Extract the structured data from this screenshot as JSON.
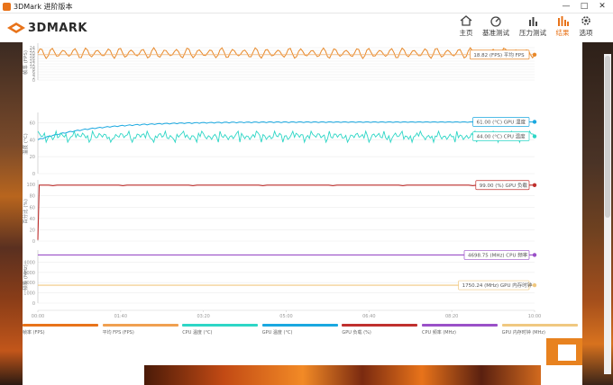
{
  "window": {
    "title": "3DMark 进阶版本",
    "minimize": "—",
    "maximize": "□",
    "close": "✕"
  },
  "header": {
    "logo": "3DMARK",
    "nav": [
      {
        "label": "主页",
        "icon": "home-icon"
      },
      {
        "label": "基准测试",
        "icon": "gauge-icon"
      },
      {
        "label": "压力测试",
        "icon": "stress-bars-icon"
      },
      {
        "label": "结果",
        "icon": "results-bars-icon",
        "active": true
      },
      {
        "label": "选项",
        "icon": "gear-icon"
      }
    ]
  },
  "colors": {
    "accent": "#e8731a",
    "fps": "#e8892a",
    "fps_avg": "#f0b070",
    "cpu_temp": "#2ed6c6",
    "gpu_temp": "#1aa8e0",
    "gpu_load": "#c0302e",
    "cpu_clock": "#9a50c8",
    "gpu_mem_clock": "#f0c880"
  },
  "chart_data": [
    {
      "type": "line",
      "ylabel": "帧率 (FPS)",
      "ylim": [
        0,
        26
      ],
      "yticks": [
        0,
        2,
        4,
        6,
        8,
        10,
        12,
        14,
        16,
        18,
        20,
        22,
        24
      ],
      "series": [
        {
          "name": "帧率 (FPS)",
          "pattern": "oscillating",
          "min": 16,
          "max": 24
        },
        {
          "name": "平均 FPS",
          "value": 18.82
        }
      ],
      "callout": "18.82 (FPS) 平均 FPS"
    },
    {
      "type": "line",
      "ylabel": "温度 (°C)",
      "ylim": [
        0,
        70
      ],
      "yticks": [
        0,
        20,
        40,
        60
      ],
      "series": [
        {
          "name": "GPU 温度 (°C)",
          "start": 40,
          "end": 61
        },
        {
          "name": "CPU 温度 (°C)",
          "mean": 44,
          "min": 37,
          "max": 50
        }
      ],
      "callouts": [
        "61.00 (°C) GPU 温度",
        "44.00 (°C) CPU 温度"
      ]
    },
    {
      "type": "line",
      "ylabel": "百分比 (%)",
      "ylim": [
        0,
        105
      ],
      "yticks": [
        0,
        20,
        40,
        60,
        80,
        100
      ],
      "series": [
        {
          "name": "GPU 负载 (%)",
          "start": 2,
          "end": 99
        }
      ],
      "callout": "99.00 (%) GPU 负载"
    },
    {
      "type": "line",
      "ylabel": "频率 (MHz)",
      "ylim": [
        0,
        5000
      ],
      "yticks": [
        0,
        1000,
        2000,
        3000,
        4000
      ],
      "series": [
        {
          "name": "CPU 频率 (MHz)",
          "value": 4698.75
        },
        {
          "name": "GPU 内存时钟 (MHz)",
          "value": 1750.24
        }
      ],
      "callouts": [
        "4698.75 (MHz) CPU 频率",
        "1750.24 (MHz) GPU 内存时钟"
      ]
    }
  ],
  "xaxis": {
    "ticks": [
      "00:00",
      "01:40",
      "03:20",
      "05:00",
      "06:40",
      "08:20",
      "10:00"
    ]
  },
  "legend": [
    {
      "label": "帧率 (FPS)",
      "color": "#e8731a"
    },
    {
      "label": "平均 FPS (FPS)",
      "color": "#f0a050"
    },
    {
      "label": "CPU 温度 (°C)",
      "color": "#2ed6c6"
    },
    {
      "label": "GPU 温度 (°C)",
      "color": "#1aa8e0"
    },
    {
      "label": "GPU 负载 (%)",
      "color": "#c0302e"
    },
    {
      "label": "CPU 频率 (MHz)",
      "color": "#9a50c8"
    },
    {
      "label": "GPU 内存时钟 (MHz)",
      "color": "#f0c880"
    }
  ]
}
